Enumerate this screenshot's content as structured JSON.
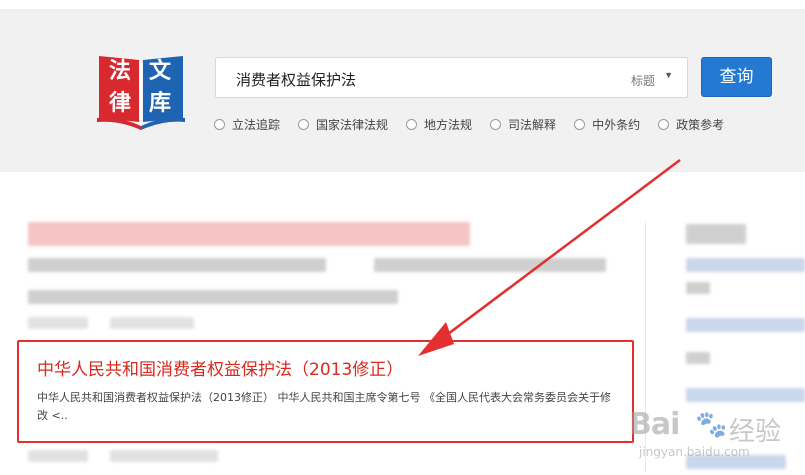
{
  "logo": {
    "chars": [
      "法",
      "律",
      "文",
      "库"
    ],
    "colors": {
      "left_page": "#d8292f",
      "right_page": "#1f63b3"
    }
  },
  "search": {
    "value": "消费者权益保护法",
    "scope": "标题",
    "button_label": "查询"
  },
  "categories": [
    {
      "label": "立法追踪"
    },
    {
      "label": "国家法律法规"
    },
    {
      "label": "地方法规"
    },
    {
      "label": "司法解释"
    },
    {
      "label": "中外条约"
    },
    {
      "label": "政策参考"
    }
  ],
  "result": {
    "title": "中华人民共和国消费者权益保护法（2013修正）",
    "snippet": "中华人民共和国消费者权益保护法（2013修正） 中华人民共和国主席令第七号 《全国人民代表大会常务委员会关于修改 <.."
  },
  "watermark": {
    "brand": "Bai",
    "suffix": "经验",
    "url": "jingyan.baidu.com"
  },
  "colors": {
    "accent": "#2479d3",
    "highlight": "#e52f2f",
    "result_title": "#d9281e"
  }
}
